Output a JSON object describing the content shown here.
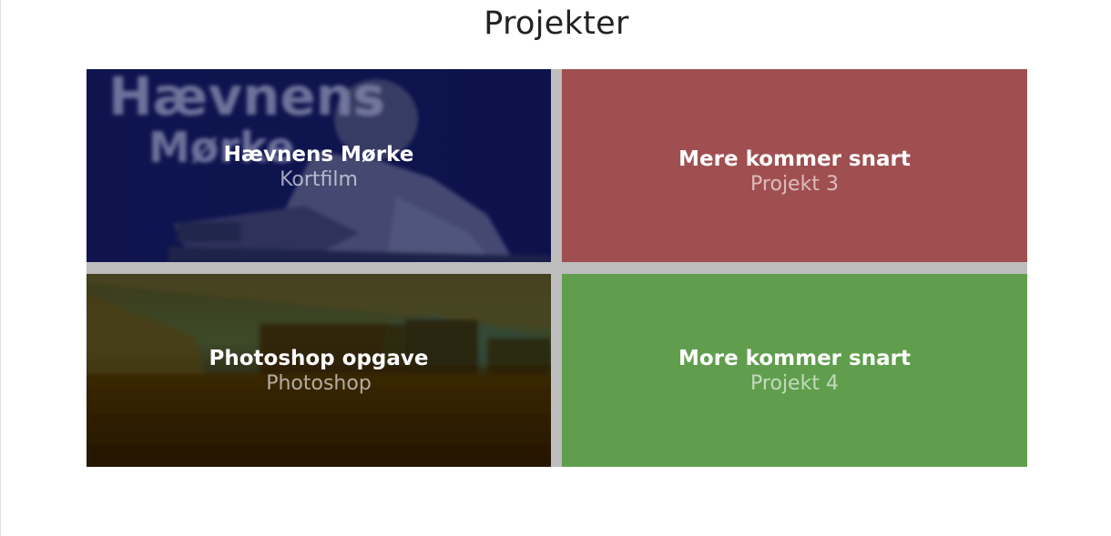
{
  "page": {
    "title": "Projekter"
  },
  "projects": [
    {
      "title": "Hævnens Mørke",
      "subtitle": "Kortfilm",
      "poster_text_line1": "Hævnens",
      "poster_text_line2": "Mørke",
      "overlay_color": "#0c1150"
    },
    {
      "title": "Mere kommer snart",
      "subtitle": "Projekt 3",
      "background_color": "#a04f50"
    },
    {
      "title": "Photoshop opgave",
      "subtitle": "Photoshop",
      "overlay_color": "#2a1d05"
    },
    {
      "title": "More kommer snart",
      "subtitle": "Projekt 4",
      "background_color": "#609e4d"
    }
  ]
}
